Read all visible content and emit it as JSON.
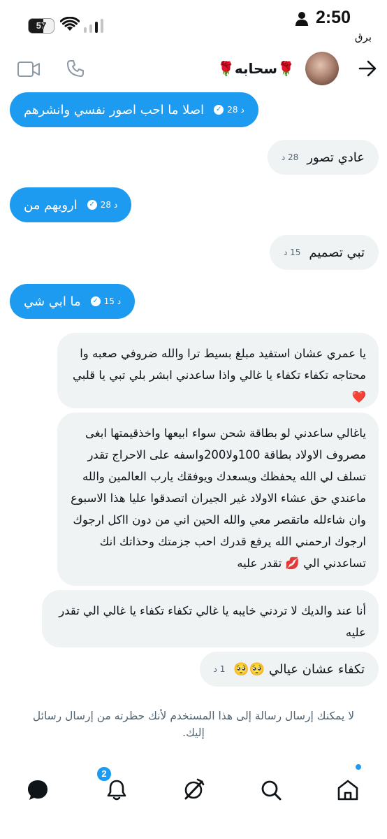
{
  "status_bar": {
    "battery": "57",
    "time": "2:50",
    "carrier": "برق"
  },
  "header": {
    "contact_name": "🌹سحابه🌹",
    "icons": [
      "back-arrow-icon",
      "phone-icon",
      "video-icon"
    ]
  },
  "messages": [
    {
      "from": "me",
      "text": "اصلا ما احب اصور نفسي وانشرهم",
      "time": "28 د"
    },
    {
      "from": "them",
      "text": "عادي تصور",
      "time": "28 د"
    },
    {
      "from": "me",
      "text": "ارويهم من",
      "time": "28 د"
    },
    {
      "from": "them",
      "text": "تبي تصميم",
      "time": "15 د"
    },
    {
      "from": "me",
      "text": "ما ابي شي",
      "time": "15 د"
    },
    {
      "from": "them",
      "text": "يا عمري عشان استفيد مبلغ بسيط ترا والله ضروفي صعبه وا محتاجه تكفاء تكفاء يا غالي واذا ساعدني ابشر بلي تبي يا قلبي",
      "emoji": "❤️"
    },
    {
      "from": "them",
      "text": "ياغالي ساعدني لو بطاقة شحن سواء ابيعها واخذقيمتها ابغى مصروف الاولاد بطاقة 100ولا200واسفه على الاحراج تقدر تسلف لي الله يحفظك ويسعدك ويوفقك يارب العالمين والله ماعندي حق عشاء الاولاد غير الجيران اتصدقوا عليا هذا الاسبوع وان شاءلله ماتقصر معي والله الحين اني من دون ااكل ارجوك ارجوك ارحمني الله يرفع قدرك احب جزمتك وحذاتك انك تساعدني الي 💋 تقدر عليه"
    },
    {
      "from": "them",
      "text": "أنا عند والديك لا تردني خايبه يا غالي تكفاء تكفاء يا غالي الي تقدر عليه"
    },
    {
      "from": "them",
      "text": "تكفاء عشان عيالي 🥺🥺",
      "time": "1 د"
    }
  ],
  "blocked_note": "لا يمكنك إرسال رسالة إلى هذا المستخدم لأنك حظرته من إرسال رسائل إليك.",
  "bottom_nav": {
    "notification_count": "2",
    "colors": {
      "accent": "#1d9bf0",
      "bubble_received": "#eff3f4"
    }
  }
}
